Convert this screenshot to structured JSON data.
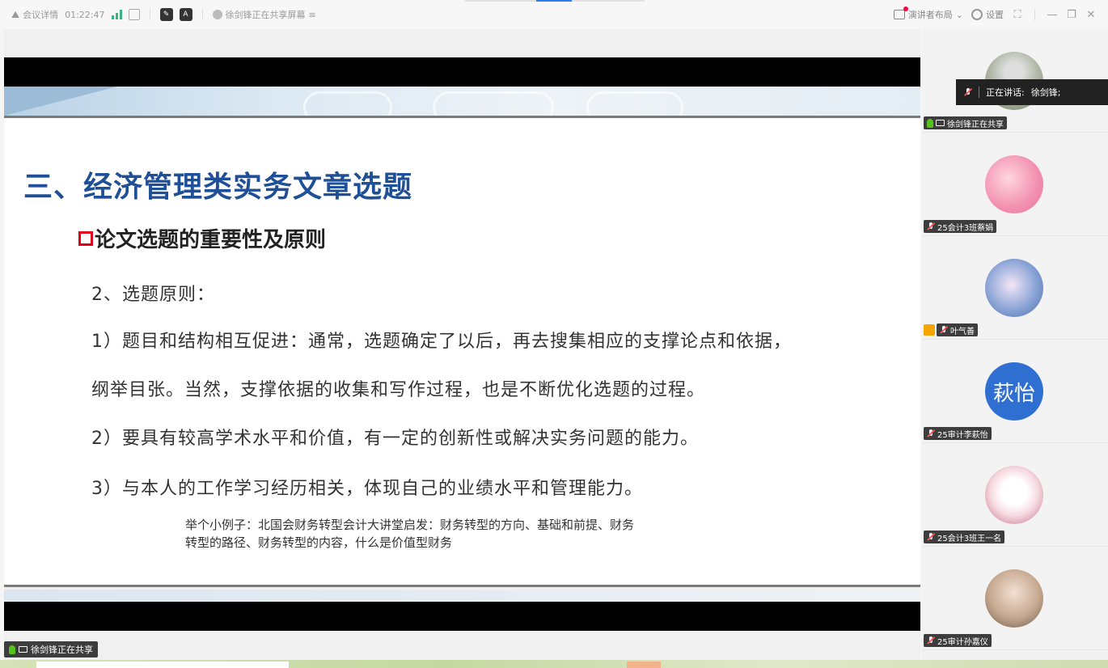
{
  "topbar": {
    "meeting_details": "会议详情",
    "elapsed": "01:22:47",
    "sharing_status": "徐剑锋正在共享屏幕",
    "presenter_layout": "演讲者布局",
    "settings": "设置"
  },
  "slide": {
    "title": "三、经济管理类实务文章选题",
    "subtitle": "论文选题的重要性及原则",
    "lines": [
      "2、选题原则：",
      "1）题目和结构相互促进：通常，选题确定了以后，再去搜集相应的支撑论点和依据，",
      "纲举目张。当然，支撑依据的收集和写作过程，也是不断优化选题的过程。",
      "2）要具有较高学术水平和价值，有一定的创新性或解决实务问题的能力。",
      "3）与本人的工作学习经历相关，体现自己的业绩水平和管理能力。"
    ],
    "note_line1": "举个小例子：北国会财务转型会计大讲堂启发：财务转型的方向、基础和前提、财务",
    "note_line2": "转型的路径、财务转型的内容，什么是价值型财务"
  },
  "share_badge": "徐剑锋正在共享",
  "speaking": {
    "label": "正在讲话:",
    "name": "徐剑锋;"
  },
  "participants": [
    {
      "name": "徐剑锋正在共享",
      "avatar_icon": "landscape-photo-avatar"
    },
    {
      "name": "25会计3班蔡娟",
      "avatar_icon": "pink-plush-avatar"
    },
    {
      "name": "叶气善",
      "avatar_icon": "anime-girl-avatar"
    },
    {
      "name": "25审计李萩怡",
      "avatar_text": "萩怡"
    },
    {
      "name": "25会计3班王一名",
      "avatar_icon": "cartoon-avatar"
    },
    {
      "name": "25审计孙嘉仪",
      "avatar_icon": "photo-avatar"
    }
  ],
  "colors": {
    "title_blue": "#1f4f96",
    "bullet_red": "#e0001b",
    "avatar_blue": "#2e6fd1",
    "mic_green": "#52c41a"
  }
}
